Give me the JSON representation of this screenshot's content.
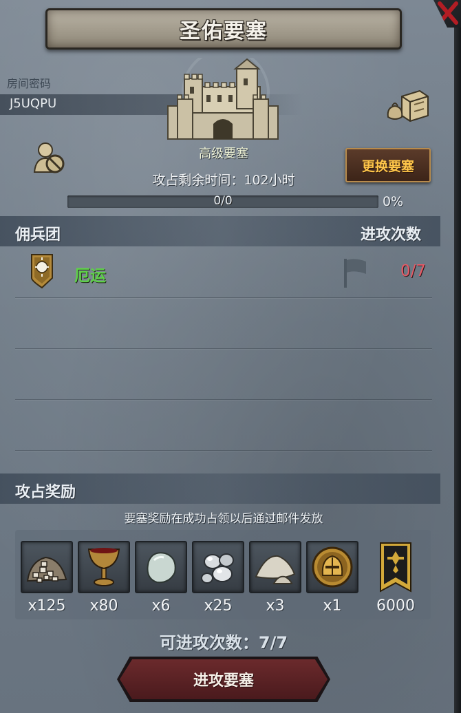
{
  "header": {
    "title": "圣佑要塞"
  },
  "room": {
    "label": "房间密码",
    "code": "J5UQPU"
  },
  "fortress": {
    "level": "高级要塞",
    "change_button": "更换要塞",
    "time_left_label": "攻占剩余时间：102小时",
    "progress_text": "0/0",
    "progress_percent": "0%",
    "progress_fraction": 0
  },
  "mercenaries": {
    "section_title": "佣兵团",
    "attack_header": "进攻次数",
    "rows": [
      {
        "name": "厄运",
        "attacks": "0/7"
      }
    ]
  },
  "rewards": {
    "section_title": "攻占奖励",
    "note": "要塞奖励在成功占领以后通过邮件发放",
    "items": [
      {
        "icon": "ore-pile-icon",
        "qty": "x125"
      },
      {
        "icon": "goblet-icon",
        "qty": "x80"
      },
      {
        "icon": "stone-icon",
        "qty": "x6"
      },
      {
        "icon": "silver-pearls-icon",
        "qty": "x25"
      },
      {
        "icon": "sand-pile-icon",
        "qty": "x3"
      },
      {
        "icon": "knight-helmet-coin-icon",
        "qty": "x1"
      },
      {
        "icon": "banner-emblem-icon",
        "qty": "6000"
      }
    ]
  },
  "footer": {
    "attacks_left": "可进攻次数：7/7",
    "attack_button": "进攻要塞"
  },
  "colors": {
    "merc_name": "#5fd04a",
    "attack_count": "#e55a66",
    "button_text": "#ffc64a"
  }
}
